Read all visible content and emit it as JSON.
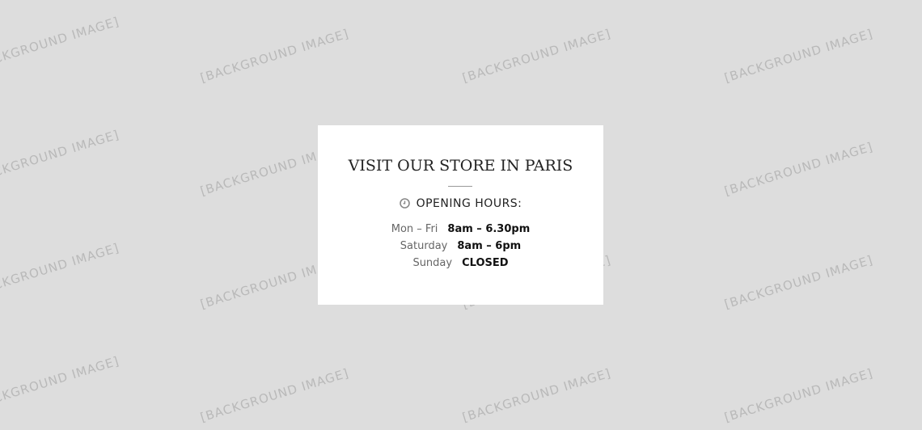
{
  "background": {
    "watermark_text": "[BACKGROUND IMAGE]"
  },
  "card": {
    "title": "VISIT OUR STORE IN PARIS",
    "hours_heading": "OPENING HOURS:",
    "hours_icon": "clock-icon",
    "hours": [
      {
        "day": "Mon – Fri",
        "time": "8am – 6.30pm"
      },
      {
        "day": "Saturday",
        "time": "8am – 6pm"
      },
      {
        "day": "Sunday",
        "time": "CLOSED"
      }
    ]
  }
}
